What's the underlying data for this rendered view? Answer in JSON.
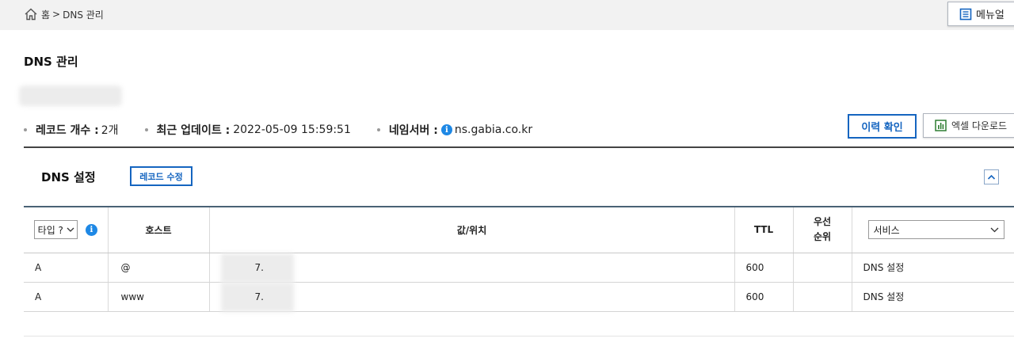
{
  "breadcrumb": {
    "home": "홈",
    "separator": ">",
    "current": "DNS 관리"
  },
  "header": {
    "manual_label": "메뉴얼"
  },
  "page": {
    "title": "DNS 관리"
  },
  "info": {
    "record_count_label": "레코드 개수 :",
    "record_count_value": "2개",
    "last_update_label": "최근 업데이트 :",
    "last_update_value": "2022-05-09 15:59:51",
    "nameserver_label": "네임서버 :",
    "nameserver_value": "ns.gabia.co.kr"
  },
  "actions": {
    "history_label": "이력 확인",
    "excel_label": "엑셀 다운로드"
  },
  "section": {
    "title": "DNS 설정",
    "edit_label": "레코드 수정"
  },
  "table": {
    "type_select_value": "타입 ?",
    "headers": {
      "host": "호스트",
      "value": "값/위치",
      "ttl": "TTL",
      "priority": "우선\n순위"
    },
    "service_select_value": "서비스",
    "rows": [
      {
        "type": "A",
        "host": "@",
        "value": "7.",
        "ttl": "600",
        "priority": "",
        "service": "DNS 설정"
      },
      {
        "type": "A",
        "host": "www",
        "value": "7.",
        "ttl": "600",
        "priority": "",
        "service": "DNS 설정"
      }
    ]
  },
  "colors": {
    "accent": "#1565c0",
    "info": "#1e88e5",
    "excel": "#2e7d32"
  }
}
